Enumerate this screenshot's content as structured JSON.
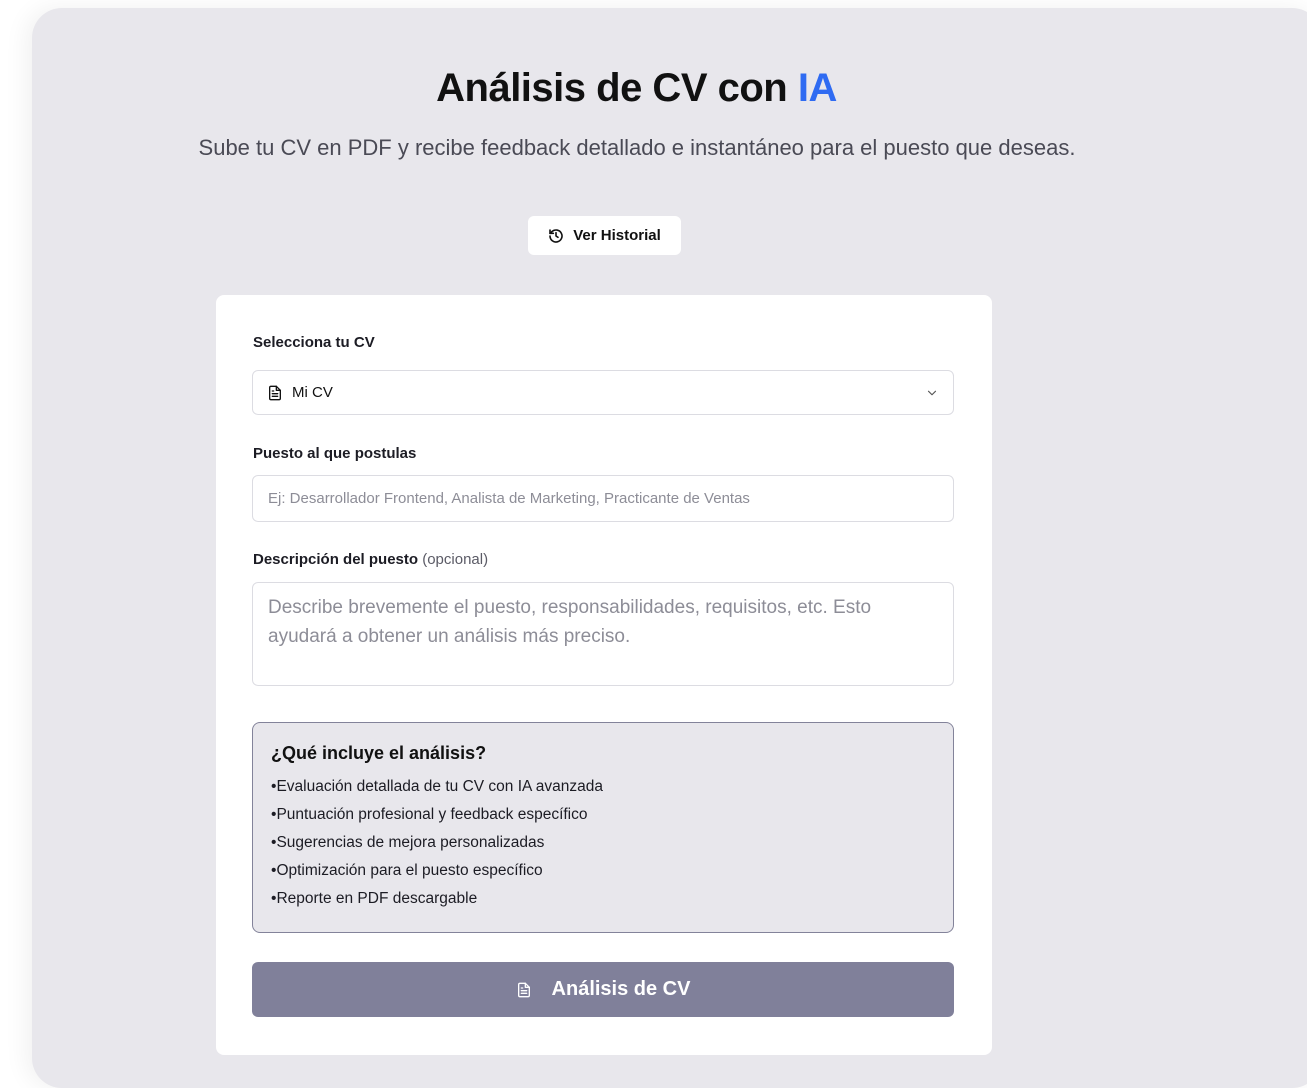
{
  "header": {
    "title_main": "Análisis de CV con",
    "title_accent": "IA",
    "subtitle": "Sube tu CV en PDF y recibe feedback detallado e instantáneo para el puesto que deseas.",
    "history_button": "Ver Historial",
    "history_icon": "history-icon"
  },
  "form": {
    "cv_label": "Selecciona tu CV",
    "cv_selected": "Mi CV",
    "cv_icon": "document-icon",
    "position_label": "Puesto al que postulas",
    "position_placeholder": "Ej: Desarrollador Frontend, Analista de Marketing, Practicante de Ventas",
    "description_label": "Descripción del puesto",
    "description_optional": "(opcional)",
    "description_placeholder": "Describe brevemente el puesto, responsabilidades, requisitos, etc. Esto ayudará a obtener un análisis más preciso."
  },
  "info": {
    "title": "¿Qué incluye el análisis?",
    "items": [
      "Evaluación detallada de tu CV con IA avanzada",
      "Puntuación profesional y feedback específico",
      "Sugerencias de mejora personalizadas",
      "Optimización para el puesto específico",
      "Reporte en PDF descargable"
    ]
  },
  "submit": {
    "label": "Análisis de CV",
    "icon": "document-icon"
  },
  "colors": {
    "accent": "#2f6bf2",
    "background": "#e8e7ec",
    "button_disabled": "#80809a"
  }
}
